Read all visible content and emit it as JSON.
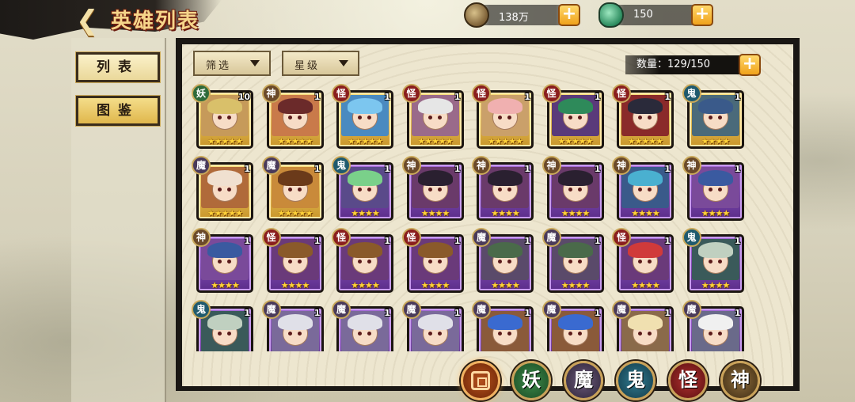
{
  "header": {
    "title": "英雄列表",
    "back_icon": "chevron-left-icon",
    "back_symbol": "❮"
  },
  "currencies": {
    "gold": {
      "value": "138万",
      "icon": "coin-icon"
    },
    "jade": {
      "value": "150",
      "icon": "jade-icon"
    },
    "plus_symbol": "+"
  },
  "sidebar": {
    "list_label": "列表",
    "atlas_label": "图鉴"
  },
  "filters": {
    "filter_label": "筛选",
    "star_label": "星级"
  },
  "count_text": "数量：129/150",
  "heroes": [
    {
      "faction": "妖",
      "level": "10",
      "rarity": "gold",
      "stars": "★★★★★",
      "hair": "#d9c06a",
      "bg": "#c69a5a"
    },
    {
      "faction": "神",
      "level": "1",
      "rarity": "gold",
      "stars": "★★★★★",
      "hair": "#6b2a2a",
      "bg": "#c97a4a"
    },
    {
      "faction": "怪",
      "level": "1",
      "rarity": "gold",
      "stars": "★★★★★",
      "hair": "#7cc6ef",
      "bg": "#4a8ac0"
    },
    {
      "faction": "怪",
      "level": "1",
      "rarity": "gold",
      "stars": "★★★★★",
      "hair": "#e6e6e6",
      "bg": "#9a6a8a"
    },
    {
      "faction": "怪",
      "level": "1",
      "rarity": "gold",
      "stars": "★★★★★",
      "hair": "#f0b0b0",
      "bg": "#caa06a"
    },
    {
      "faction": "怪",
      "level": "1",
      "rarity": "gold",
      "stars": "★★★★★",
      "hair": "#2e8a5a",
      "bg": "#5a3a7a"
    },
    {
      "faction": "怪",
      "level": "1",
      "rarity": "gold",
      "stars": "★★★★★",
      "hair": "#2a2a3a",
      "bg": "#8a2a2a"
    },
    {
      "faction": "鬼",
      "level": "1",
      "rarity": "gold",
      "stars": "★★★★",
      "hair": "#3a5a8a",
      "bg": "#4a6a7a"
    },
    {
      "faction": "魔",
      "level": "1",
      "rarity": "gold",
      "stars": "★★★★★",
      "hair": "#f0e0d0",
      "bg": "#b06a3a"
    },
    {
      "faction": "魔",
      "level": "1",
      "rarity": "gold",
      "stars": "★★★★★",
      "hair": "#6b3a1a",
      "bg": "#c98a3a"
    },
    {
      "faction": "鬼",
      "level": "1",
      "rarity": "purple",
      "stars": "★★★★",
      "hair": "#7ad08a",
      "bg": "#5a4a8a"
    },
    {
      "faction": "神",
      "level": "1",
      "rarity": "purple",
      "stars": "★★★★",
      "hair": "#2a2030",
      "bg": "#6a3a6a"
    },
    {
      "faction": "神",
      "level": "1",
      "rarity": "purple",
      "stars": "★★★★",
      "hair": "#2a2030",
      "bg": "#6a3a6a"
    },
    {
      "faction": "神",
      "level": "1",
      "rarity": "purple",
      "stars": "★★★★",
      "hair": "#2a2030",
      "bg": "#6a3a6a"
    },
    {
      "faction": "神",
      "level": "1",
      "rarity": "purple",
      "stars": "★★★★",
      "hair": "#4ab0d0",
      "bg": "#3a5a8a"
    },
    {
      "faction": "神",
      "level": "1",
      "rarity": "purple",
      "stars": "★★★★",
      "hair": "#3a5aa0",
      "bg": "#7a4a9a"
    },
    {
      "faction": "神",
      "level": "1",
      "rarity": "purple",
      "stars": "★★★★",
      "hair": "#3a5aa0",
      "bg": "#7a4a9a"
    },
    {
      "faction": "怪",
      "level": "1",
      "rarity": "purple",
      "stars": "★★★★",
      "hair": "#8a5a2a",
      "bg": "#6a3a7a"
    },
    {
      "faction": "怪",
      "level": "1",
      "rarity": "purple",
      "stars": "★★★★",
      "hair": "#8a5a2a",
      "bg": "#6a3a7a"
    },
    {
      "faction": "怪",
      "level": "1",
      "rarity": "purple",
      "stars": "★★★★",
      "hair": "#8a5a2a",
      "bg": "#6a3a7a"
    },
    {
      "faction": "魔",
      "level": "1",
      "rarity": "purple",
      "stars": "★★★★",
      "hair": "#4a6a4a",
      "bg": "#5a4a6a"
    },
    {
      "faction": "魔",
      "level": "1",
      "rarity": "purple",
      "stars": "★★★★",
      "hair": "#4a6a4a",
      "bg": "#5a4a6a"
    },
    {
      "faction": "怪",
      "level": "1",
      "rarity": "purple",
      "stars": "★★★★",
      "hair": "#d03a3a",
      "bg": "#6a3a7a"
    },
    {
      "faction": "鬼",
      "level": "1",
      "rarity": "purple",
      "stars": "★★★★",
      "hair": "#c0d0c0",
      "bg": "#3a5a5a"
    },
    {
      "faction": "鬼",
      "level": "1",
      "rarity": "purple",
      "stars": "★★★★",
      "hair": "#c0d0c0",
      "bg": "#3a5a5a"
    },
    {
      "faction": "魔",
      "level": "1",
      "rarity": "purple",
      "stars": "★★★★",
      "hair": "#e0e0e8",
      "bg": "#7a6a9a"
    },
    {
      "faction": "魔",
      "level": "1",
      "rarity": "purple",
      "stars": "★★★★",
      "hair": "#e0e0e8",
      "bg": "#7a6a9a"
    },
    {
      "faction": "魔",
      "level": "1",
      "rarity": "purple",
      "stars": "★★★★",
      "hair": "#e0e0e8",
      "bg": "#7a6a9a"
    },
    {
      "faction": "魔",
      "level": "1",
      "rarity": "purple",
      "stars": "★★★★",
      "hair": "#3a6ad0",
      "bg": "#8a5a3a"
    },
    {
      "faction": "魔",
      "level": "1",
      "rarity": "purple",
      "stars": "★★★★",
      "hair": "#3a6ad0",
      "bg": "#8a5a3a"
    },
    {
      "faction": "魔",
      "level": "1",
      "rarity": "purple",
      "stars": "★★★★",
      "hair": "#f0e0b0",
      "bg": "#8a6a4a"
    },
    {
      "faction": "魔",
      "level": "1",
      "rarity": "purple",
      "stars": "★★★★",
      "hair": "#f0f0f0",
      "bg": "#6a6a8a"
    }
  ],
  "factions": [
    {
      "key": "all",
      "label": ""
    },
    {
      "key": "yao",
      "label": "妖"
    },
    {
      "key": "mo",
      "label": "魔"
    },
    {
      "key": "gui",
      "label": "鬼"
    },
    {
      "key": "guai",
      "label": "怪"
    },
    {
      "key": "shen",
      "label": "神"
    }
  ],
  "colors": {
    "accent_gold": "#f0a21b",
    "rarity_gold": "#c9962b",
    "rarity_purple": "#5b2d8a"
  }
}
